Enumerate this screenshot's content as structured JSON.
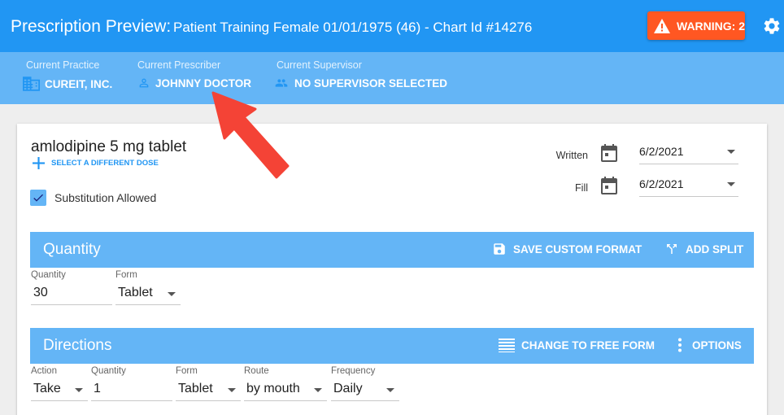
{
  "header": {
    "title": "Prescription Preview:",
    "patient": "Patient Training Female 01/01/1975 (46) - Chart Id #14276",
    "warning_label": "WARNING: 2"
  },
  "practice_bar": {
    "practice": {
      "label": "Current Practice",
      "value": "CUREIT, INC."
    },
    "prescriber": {
      "label": "Current Prescriber",
      "value": "JOHNNY DOCTOR"
    },
    "supervisor": {
      "label": "Current Supervisor",
      "value": "NO SUPERVISOR SELECTED"
    }
  },
  "drug": {
    "name": "amlodipine 5 mg tablet",
    "select_dose": "SELECT A DIFFERENT DOSE",
    "substitution": "Substitution Allowed",
    "substitution_checked": true
  },
  "dates": {
    "written": {
      "label": "Written",
      "value": "6/2/2021"
    },
    "fill": {
      "label": "Fill",
      "value": "6/2/2021"
    }
  },
  "quantity_section": {
    "title": "Quantity",
    "save_custom": "SAVE CUSTOM FORMAT",
    "add_split": "ADD SPLIT",
    "quantity": {
      "label": "Quantity",
      "value": "30"
    },
    "form": {
      "label": "Form",
      "value": "Tablet"
    }
  },
  "directions_section": {
    "title": "Directions",
    "change_free": "CHANGE TO FREE FORM",
    "options": "OPTIONS",
    "action": {
      "label": "Action",
      "value": "Take"
    },
    "quantity": {
      "label": "Quantity",
      "value": "1"
    },
    "form": {
      "label": "Form",
      "value": "Tablet"
    },
    "route": {
      "label": "Route",
      "value": "by mouth"
    },
    "frequency": {
      "label": "Frequency",
      "value": "Daily"
    }
  },
  "colors": {
    "primary": "#2196f3",
    "light_primary": "#64b5f6",
    "warning": "#ff5722",
    "arrow": "#f44336"
  }
}
